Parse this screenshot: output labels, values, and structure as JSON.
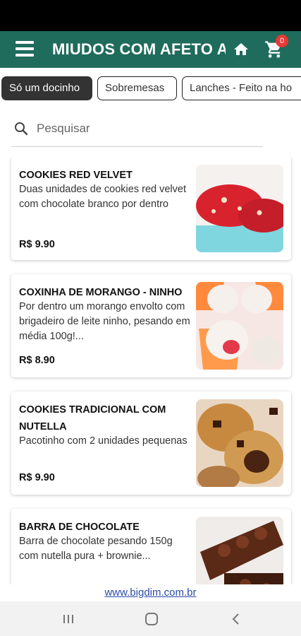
{
  "header": {
    "title": "MIUDOS COM AFETO A",
    "cart_count": "0",
    "color": "#1f6b5c"
  },
  "categories": [
    {
      "label": "Só um docinho",
      "active": true
    },
    {
      "label": "Sobremesas",
      "active": false
    },
    {
      "label": "Lanches - Feito na ho",
      "active": false
    }
  ],
  "search": {
    "placeholder": "Pesquisar"
  },
  "products": [
    {
      "name": "COOKIES RED VELVET",
      "description": "Duas unidades de cookies red velvet com chocolate branco por dentro",
      "price": "R$ 9.90"
    },
    {
      "name": "COXINHA DE MORANGO - NINHO",
      "description": "Por dentro um morango envolto com brigadeiro de leite ninho, pesando em média 100g!...",
      "price": "R$ 8.90"
    },
    {
      "name": "COOKIES TRADICIONAL COM NUTELLA",
      "description": "Pacotinho com 2 unidades pequenas",
      "price": "R$ 9.90"
    },
    {
      "name": "BARRA DE CHOCOLATE",
      "description": "Barra de chocolate pesando 150g com nutella pura + brownie...",
      "price": ""
    }
  ],
  "footer": {
    "link": "www.bigdim.com.br"
  },
  "icons": [
    "menu-icon",
    "home-icon",
    "cart-icon",
    "search-icon",
    "recents-icon",
    "home-nav-icon",
    "back-icon"
  ]
}
